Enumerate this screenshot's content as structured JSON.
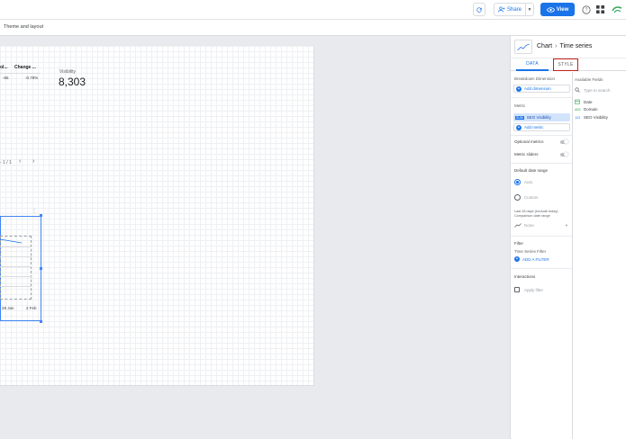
{
  "toolbar": {
    "share_label": "Share",
    "view_label": "View",
    "theme_layout_label": "Theme and layout"
  },
  "canvas": {
    "table": {
      "headers": [
        "ol...",
        "Change ..."
      ],
      "row": [
        "-65",
        "-0.78%"
      ]
    },
    "scorecard": {
      "label": "Visibility",
      "value": "8,303"
    },
    "pager": {
      "text": "- 1 / 1"
    },
    "timeseries": {
      "x_ticks": [
        "28 Jan",
        "2 Feb"
      ]
    }
  },
  "panel": {
    "breadcrumb": {
      "chart": "Chart",
      "type": "Time series"
    },
    "tabs": {
      "data": "DATA",
      "style": "STYLE"
    },
    "breakdown_dimension_title": "Breakdown Dimension",
    "add_dimension": "Add dimension",
    "metric_title": "Metric",
    "metric_chip": {
      "tag": "SUM",
      "label": "SEO Visibility"
    },
    "add_metric": "Add metric",
    "optional_metrics": "Optional metrics",
    "metric_sliders": "Metric sliders",
    "default_date_range_title": "Default date range",
    "auto_label": "Auto",
    "custom_label": "Custom",
    "last_days_note": "Last 28 days (exclude today)",
    "comparison_note": "Comparison date range",
    "comparison_value": "None",
    "filter_title": "Filter",
    "time_series_filter": "Time Series Filter",
    "add_filter": "ADD A FILTER",
    "interactions_title": "Interactions",
    "apply_filter": "Apply filter",
    "available_fields_title": "Available Fields",
    "search_placeholder": "Type to search",
    "fields": [
      {
        "type": "date",
        "name": "Date"
      },
      {
        "type": "ABC",
        "name": "Domain"
      },
      {
        "type": "123",
        "name": "SEO Visibility"
      }
    ]
  },
  "colors": {
    "accent": "#1a73e8",
    "highlight_outline": "#c5221f",
    "chip_bg": "#d2e3fc"
  }
}
